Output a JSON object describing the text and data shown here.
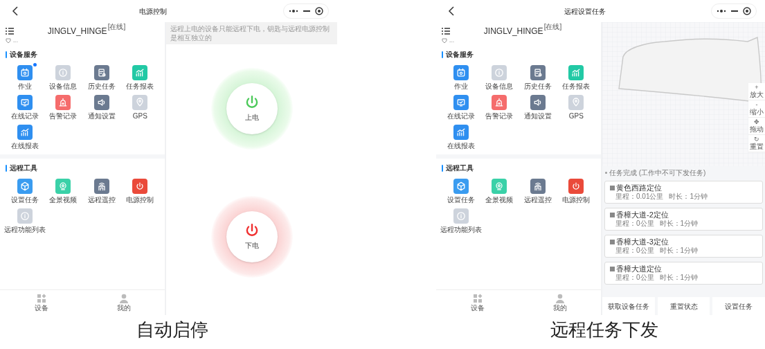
{
  "panels": [
    {
      "kind": "power",
      "title": "电源控制",
      "device_name": "JINGLV_HINGE",
      "device_tag": "[在线]",
      "device_status": "---",
      "sections": [
        {
          "title": "设备服务",
          "items": [
            {
              "label": "作业",
              "color": "#2f8ff0",
              "badge": true
            },
            {
              "label": "设备信息",
              "color": "#cdd3dc",
              "badge": false
            },
            {
              "label": "历史任务",
              "color": "#6b7a90",
              "badge": false
            },
            {
              "label": "任务报表",
              "color": "#22c9a5",
              "badge": false
            },
            {
              "label": "在线记录",
              "color": "#2f8ff0",
              "badge": false
            },
            {
              "label": "告警记录",
              "color": "#f56c6c",
              "badge": false
            },
            {
              "label": "通知设置",
              "color": "#6b7a90",
              "badge": false
            },
            {
              "label": "GPS",
              "color": "#cdd3dc",
              "badge": false
            },
            {
              "label": "在线报表",
              "color": "#2f8ff0",
              "badge": false
            }
          ]
        },
        {
          "title": "远程工具",
          "items": [
            {
              "label": "设置任务",
              "color": "#3a9cf0",
              "badge": false
            },
            {
              "label": "全景视频",
              "color": "#3ad1a8",
              "badge": false
            },
            {
              "label": "远程遥控",
              "color": "#6b7a90",
              "badge": false
            },
            {
              "label": "电源控制",
              "color": "#ea4a3a",
              "badge": false
            },
            {
              "label": "远程功能列表",
              "color": "#cdd3dc",
              "badge": false
            }
          ]
        }
      ],
      "tabbar": [
        "设备",
        "我的"
      ],
      "notice": "远程上电的设备只能远程下电，钥匙与远程电源控制是相互独立的",
      "power_buttons": [
        {
          "label": "上电",
          "kind": "on"
        },
        {
          "label": "下电",
          "kind": "off"
        }
      ],
      "caption": "自动启停"
    },
    {
      "kind": "tasks",
      "title": "远程设置任务",
      "device_name": "JINGLV_HINGE",
      "device_tag": "[在线]",
      "device_status": "---",
      "sections": [
        {
          "title": "设备服务",
          "items": [
            {
              "label": "作业",
              "color": "#2f8ff0",
              "badge": false
            },
            {
              "label": "设备信息",
              "color": "#cdd3dc",
              "badge": false
            },
            {
              "label": "历史任务",
              "color": "#6b7a90",
              "badge": false
            },
            {
              "label": "任务报表",
              "color": "#22c9a5",
              "badge": false
            },
            {
              "label": "在线记录",
              "color": "#2f8ff0",
              "badge": false
            },
            {
              "label": "告警记录",
              "color": "#f56c6c",
              "badge": false
            },
            {
              "label": "通知设置",
              "color": "#6b7a90",
              "badge": false
            },
            {
              "label": "GPS",
              "color": "#cdd3dc",
              "badge": false
            },
            {
              "label": "在线报表",
              "color": "#2f8ff0",
              "badge": false
            }
          ]
        },
        {
          "title": "远程工具",
          "items": [
            {
              "label": "设置任务",
              "color": "#3a9cf0",
              "badge": false
            },
            {
              "label": "全景视频",
              "color": "#3ad1a8",
              "badge": false
            },
            {
              "label": "远程遥控",
              "color": "#6b7a90",
              "badge": false
            },
            {
              "label": "电源控制",
              "color": "#ea4a3a",
              "badge": false
            },
            {
              "label": "远程功能列表",
              "color": "#cdd3dc",
              "badge": false
            }
          ]
        }
      ],
      "tabbar": [
        "设备",
        "我的"
      ],
      "map_controls": [
        {
          "symbol": "+",
          "label": "放大"
        },
        {
          "symbol": "-",
          "label": "缩小"
        },
        {
          "symbol": "✥",
          "label": "拖动"
        },
        {
          "symbol": "↻",
          "label": "重置"
        }
      ],
      "task_status": "任务完成 (工作中不可下发任务)",
      "tasks": [
        {
          "name": "黄色西路定位",
          "distance": "里程：0.01公里",
          "duration": "时长：1分钟"
        },
        {
          "name": "香樟大道-2定位",
          "distance": "里程：0公里",
          "duration": "时长：1分钟"
        },
        {
          "name": "香樟大道-3定位",
          "distance": "里程：0公里",
          "duration": "时长：1分钟"
        },
        {
          "name": "香樟大道定位",
          "distance": "里程：0公里",
          "duration": "时长：1分钟"
        }
      ],
      "actions": [
        "获取设备任务",
        "重置状态",
        "设置任务"
      ],
      "caption": "远程任务下发"
    }
  ]
}
